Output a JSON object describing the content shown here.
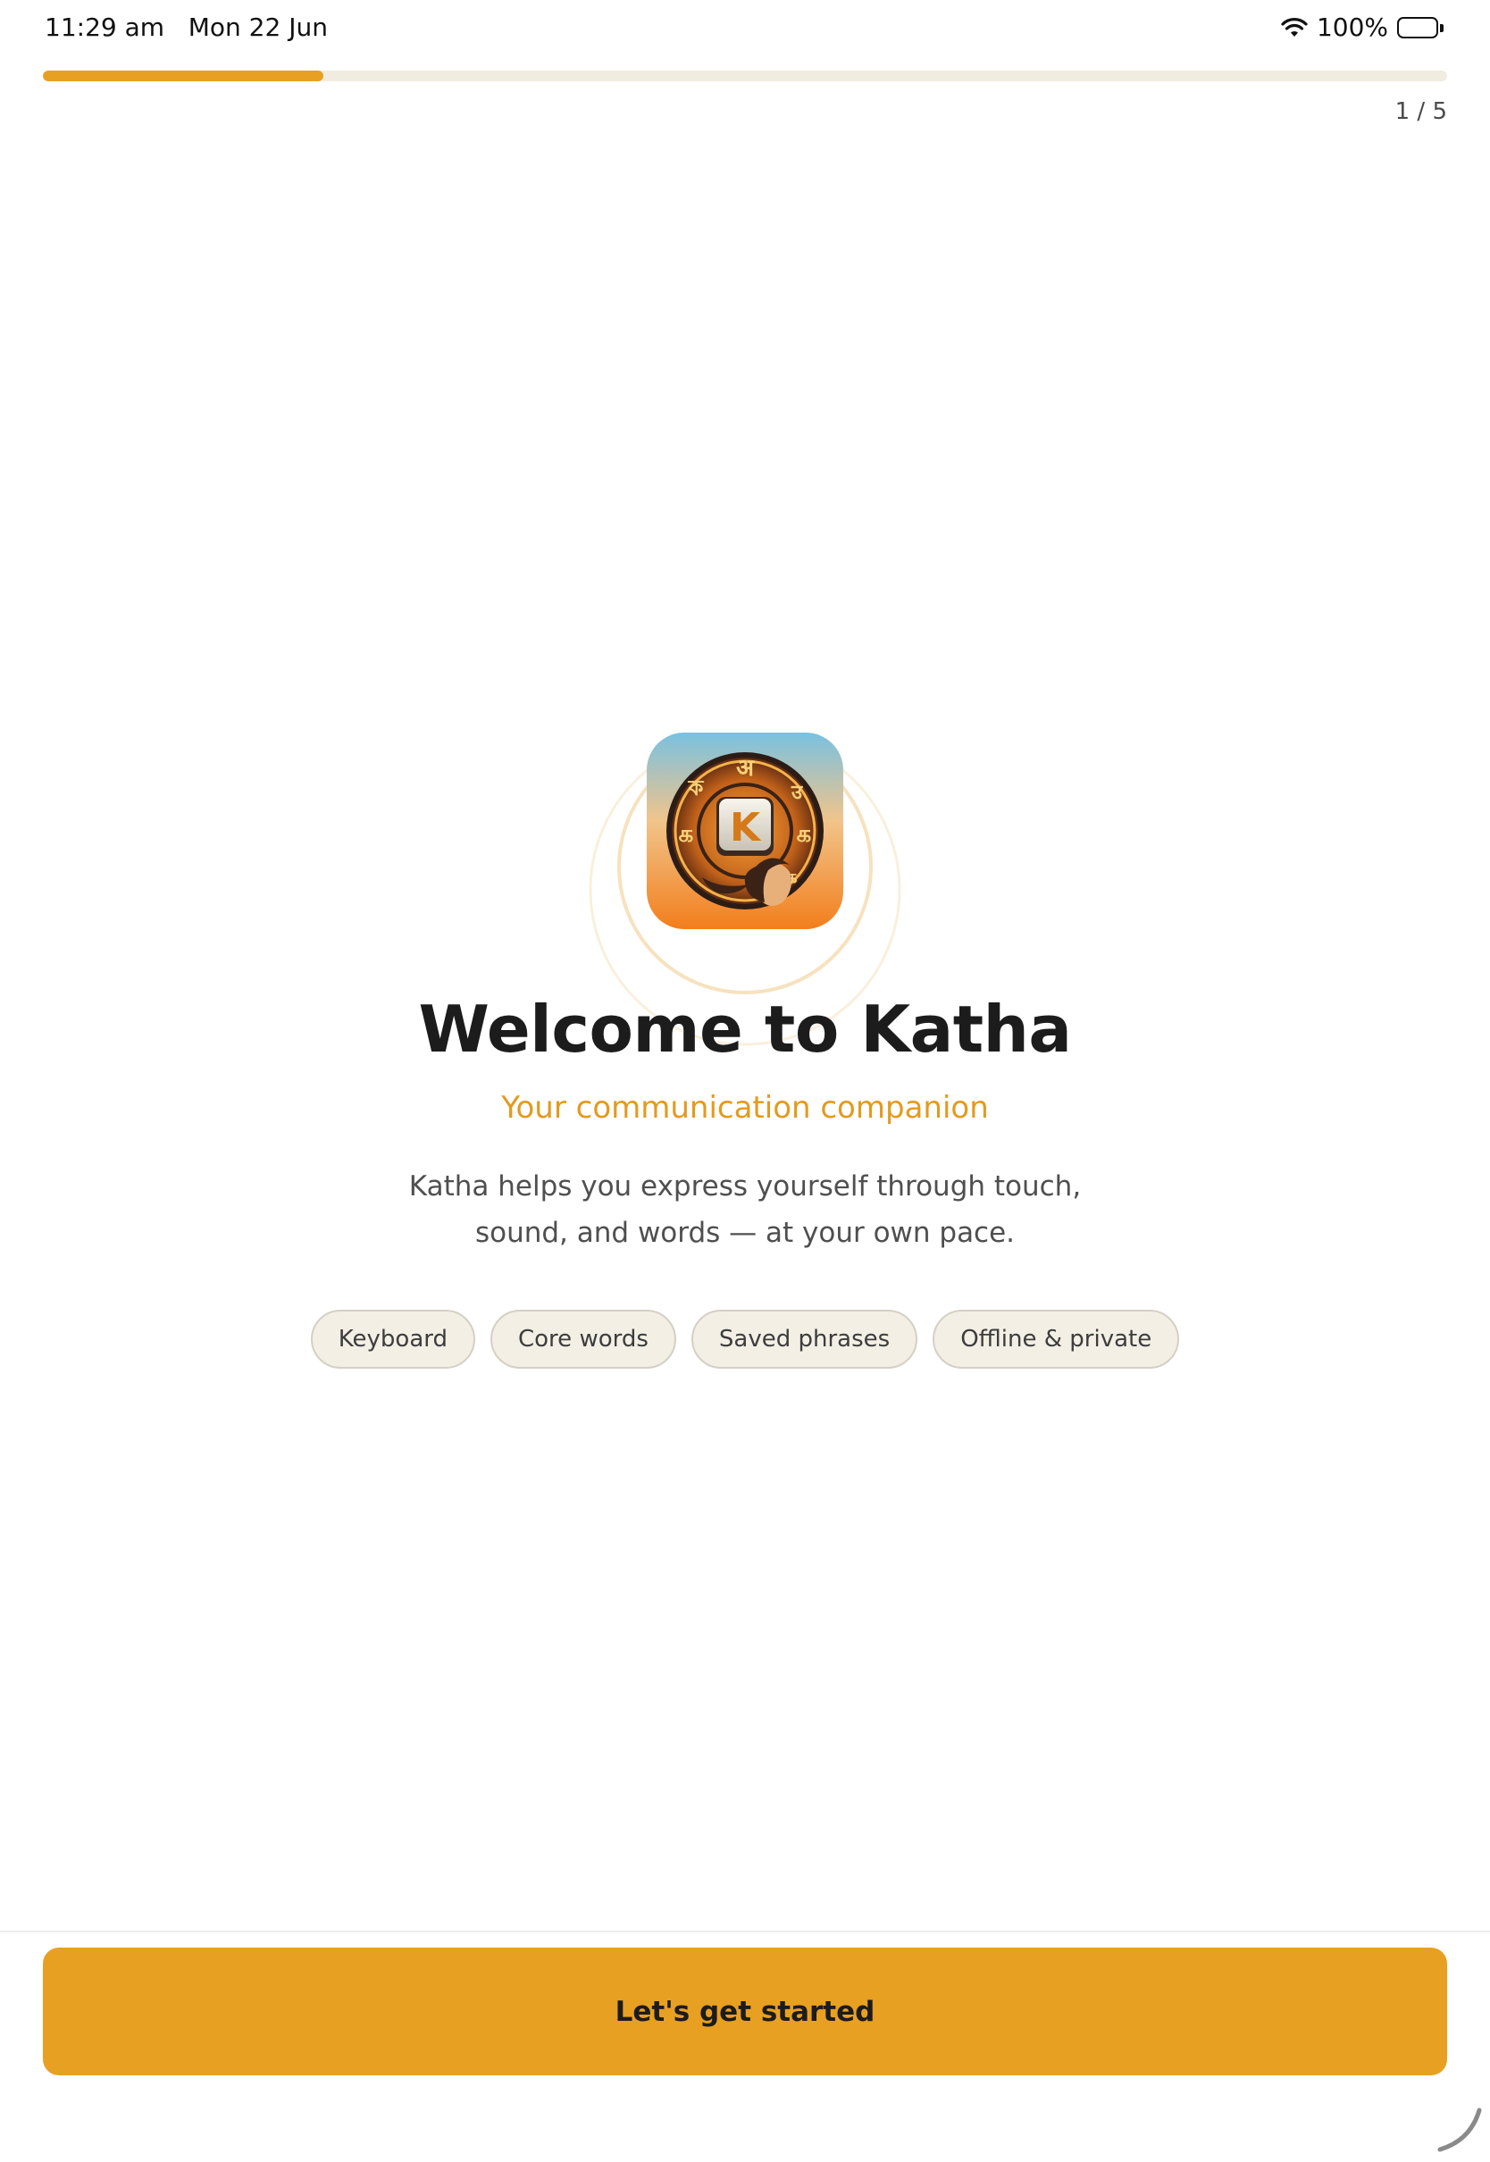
{
  "status_bar": {
    "time": "11:29 am",
    "date": "Mon 22 Jun",
    "battery": "100%",
    "icons": [
      "wifi-icon",
      "battery-icon"
    ]
  },
  "progress": {
    "fraction": 0.2,
    "counter": "1 / 5"
  },
  "logo": {
    "name": "katha-app-logo",
    "letter": "K",
    "ring_glyphs": [
      "अ",
      "उ",
      "ক",
      "க",
      "க",
      "க"
    ]
  },
  "welcome": {
    "title": "Welcome to Katha",
    "subtitle": "Your communication companion",
    "description": "Katha helps you express yourself through touch, sound, and words — at your own pace."
  },
  "features": [
    "Keyboard",
    "Core words",
    "Saved phrases",
    "Offline & private"
  ],
  "cta": {
    "label": "Let's get started"
  },
  "colors": {
    "accent": "#e8a022",
    "subtitle": "#e39a1e",
    "chip_bg": "#f3efe5",
    "progress_track": "#f1ece0"
  }
}
